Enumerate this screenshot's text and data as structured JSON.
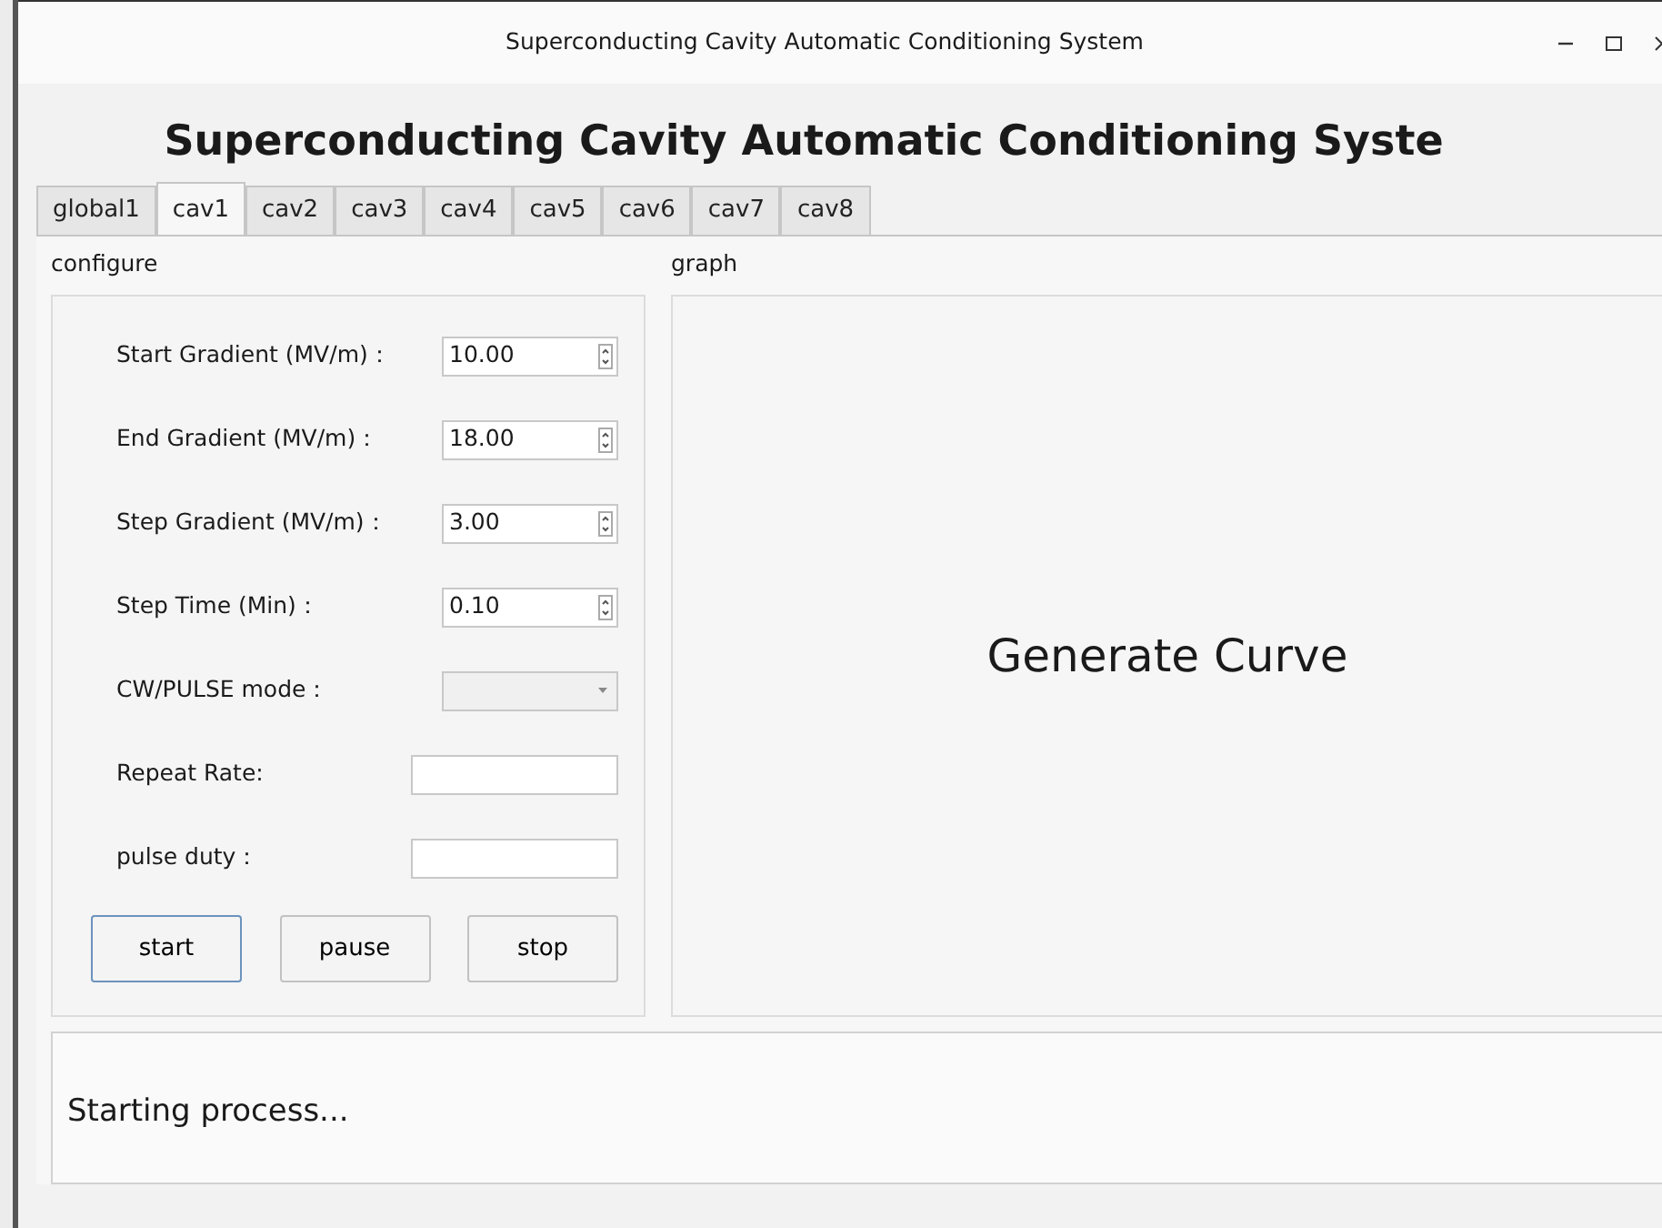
{
  "window": {
    "title": "Superconducting Cavity Automatic Conditioning System"
  },
  "heading": "Superconducting Cavity Automatic Conditioning Syste",
  "tabs": [
    {
      "label": "global1",
      "selected": false
    },
    {
      "label": "cav1",
      "selected": true
    },
    {
      "label": "cav2",
      "selected": false
    },
    {
      "label": "cav3",
      "selected": false
    },
    {
      "label": "cav4",
      "selected": false
    },
    {
      "label": "cav5",
      "selected": false
    },
    {
      "label": "cav6",
      "selected": false
    },
    {
      "label": "cav7",
      "selected": false
    },
    {
      "label": "cav8",
      "selected": false
    }
  ],
  "configure": {
    "title": "configure",
    "fields": [
      {
        "kind": "spin",
        "label": "Start Gradient (MV/m)：",
        "value": "10.00"
      },
      {
        "kind": "spin",
        "label": "End Gradient (MV/m)：",
        "value": "18.00"
      },
      {
        "kind": "spin",
        "label": "Step Gradient (MV/m)：",
        "value": "3.00"
      },
      {
        "kind": "spin",
        "label": "Step Time (Min)：",
        "value": "0.10"
      },
      {
        "kind": "combo",
        "label": "CW/PULSE mode："
      },
      {
        "kind": "text",
        "label": "Repeat Rate:"
      },
      {
        "kind": "text",
        "label": "pulse duty："
      }
    ],
    "buttons": [
      {
        "label": "start",
        "focused": true
      },
      {
        "label": "pause",
        "focused": false
      },
      {
        "label": "stop",
        "focused": false
      }
    ]
  },
  "graph": {
    "title": "graph",
    "placeholder": "Generate Curve"
  },
  "log": {
    "text": "Starting process..."
  }
}
